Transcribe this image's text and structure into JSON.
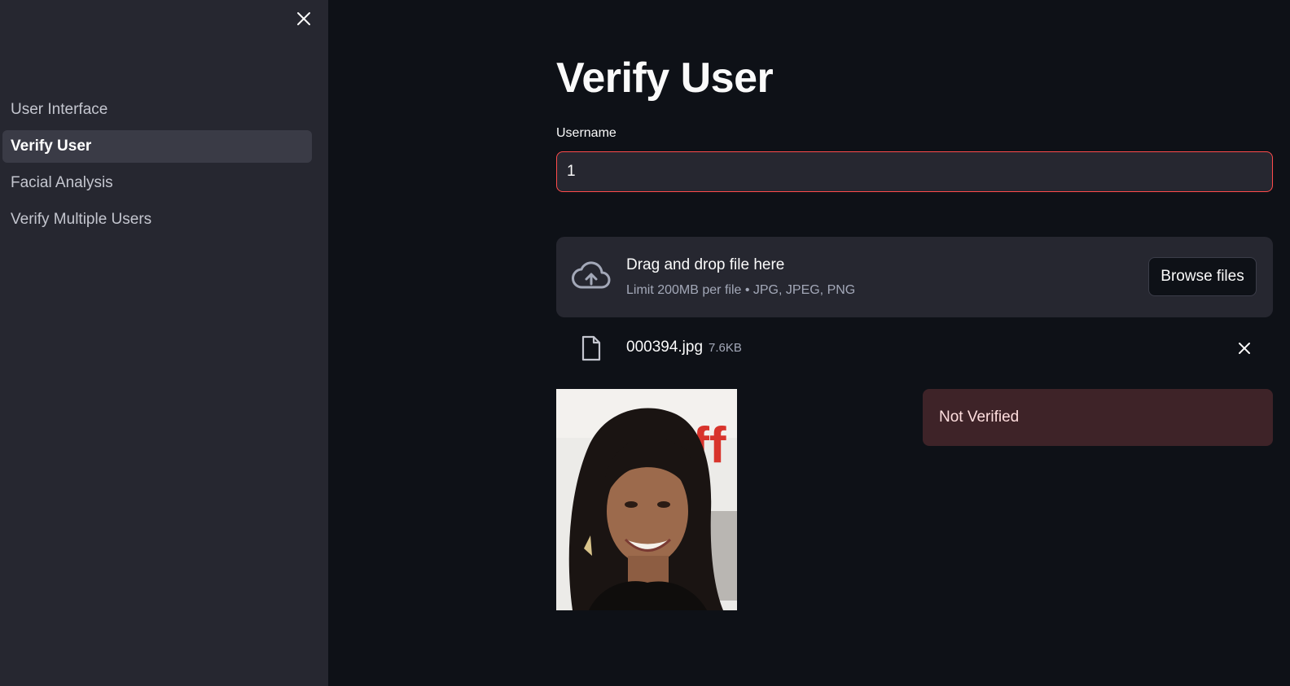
{
  "sidebar": {
    "close_icon": "close-icon",
    "items": [
      {
        "label": "User Interface",
        "active": false
      },
      {
        "label": "Verify User",
        "active": true
      },
      {
        "label": "Facial Analysis",
        "active": false
      },
      {
        "label": "Verify Multiple Users",
        "active": false
      }
    ]
  },
  "main": {
    "title": "Verify User",
    "username": {
      "label": "Username",
      "value": "1"
    },
    "uploader": {
      "icon": "cloud-upload-icon",
      "title": "Drag and drop file here",
      "subtitle": "Limit 200MB per file • JPG, JPEG, PNG",
      "browse_label": "Browse files"
    },
    "file": {
      "icon": "file-icon",
      "name": "000394.jpg",
      "size": "7.6KB",
      "remove_icon": "close-icon"
    },
    "status": "Not Verified"
  },
  "colors": {
    "background": "#0e1117",
    "sidebar": "#262730",
    "accent_error": "#ff4b4b",
    "alert_bg": "#3e2328"
  }
}
